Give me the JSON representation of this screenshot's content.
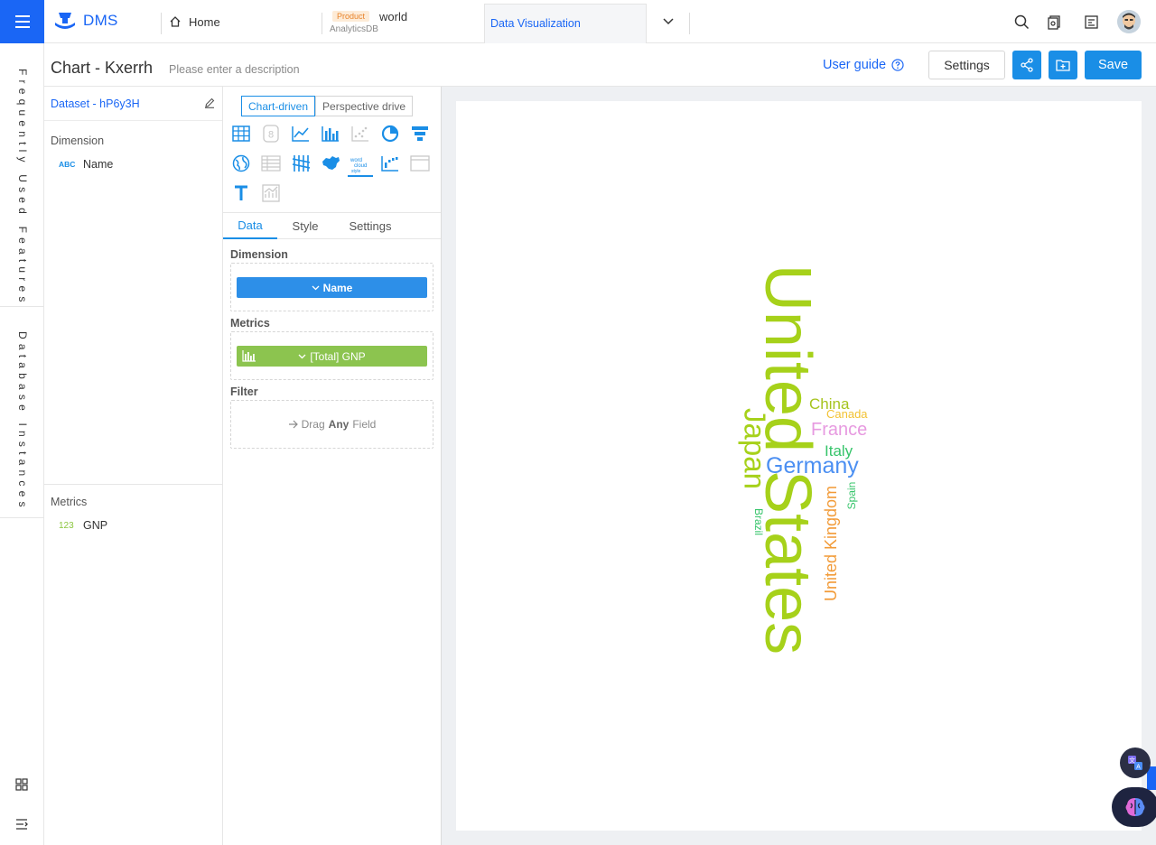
{
  "topbar": {
    "logo_text": "DMS",
    "tabs": {
      "home": "Home",
      "world_badge": "Product",
      "world_title": "world",
      "world_sub": "AnalyticsDB",
      "data_vis": "Data Visualization"
    }
  },
  "rail": {
    "frequently_used": "Frequently Used Features",
    "database_instances": "Database Instances"
  },
  "header": {
    "title": "Chart - Kxerrh",
    "description_placeholder": "Please enter a description",
    "user_guide": "User guide",
    "settings": "Settings",
    "save": "Save"
  },
  "dataset": {
    "name": "Dataset - hP6y3H",
    "dimension_title": "Dimension",
    "dimension_fields": [
      {
        "type": "ABC",
        "name": "Name"
      }
    ],
    "metrics_title": "Metrics",
    "metric_fields": [
      {
        "type": "123",
        "name": "GNP"
      }
    ]
  },
  "config": {
    "mode_tabs": [
      "Chart-driven",
      "Perspective drive"
    ],
    "tabs": [
      "Data",
      "Style",
      "Settings"
    ],
    "dimension_label": "Dimension",
    "dimension_pill": "Name",
    "metrics_label": "Metrics",
    "metrics_pill": "[Total] GNP",
    "filter_label": "Filter",
    "filter_hint_pre": "Drag",
    "filter_hint_bold": "Any",
    "filter_hint_post": "Field"
  },
  "wordcloud": {
    "words": [
      {
        "text": "United States",
        "color": "#a6d11a"
      },
      {
        "text": "Japan",
        "color": "#a6d11a"
      },
      {
        "text": "China",
        "color": "#a6c41e"
      },
      {
        "text": "Canada",
        "color": "#f2c233"
      },
      {
        "text": "France",
        "color": "#e79ae0"
      },
      {
        "text": "Italy",
        "color": "#36c46a"
      },
      {
        "text": "Germany",
        "color": "#4b8ff2"
      },
      {
        "text": "United Kingdom",
        "color": "#f29b38"
      },
      {
        "text": "Spain",
        "color": "#36c46a"
      },
      {
        "text": "Brazil",
        "color": "#36c46a"
      }
    ]
  },
  "colors": {
    "brand_blue": "#1a66f5",
    "button_blue": "#1a8ee6",
    "metric_green": "#8cc44f"
  }
}
